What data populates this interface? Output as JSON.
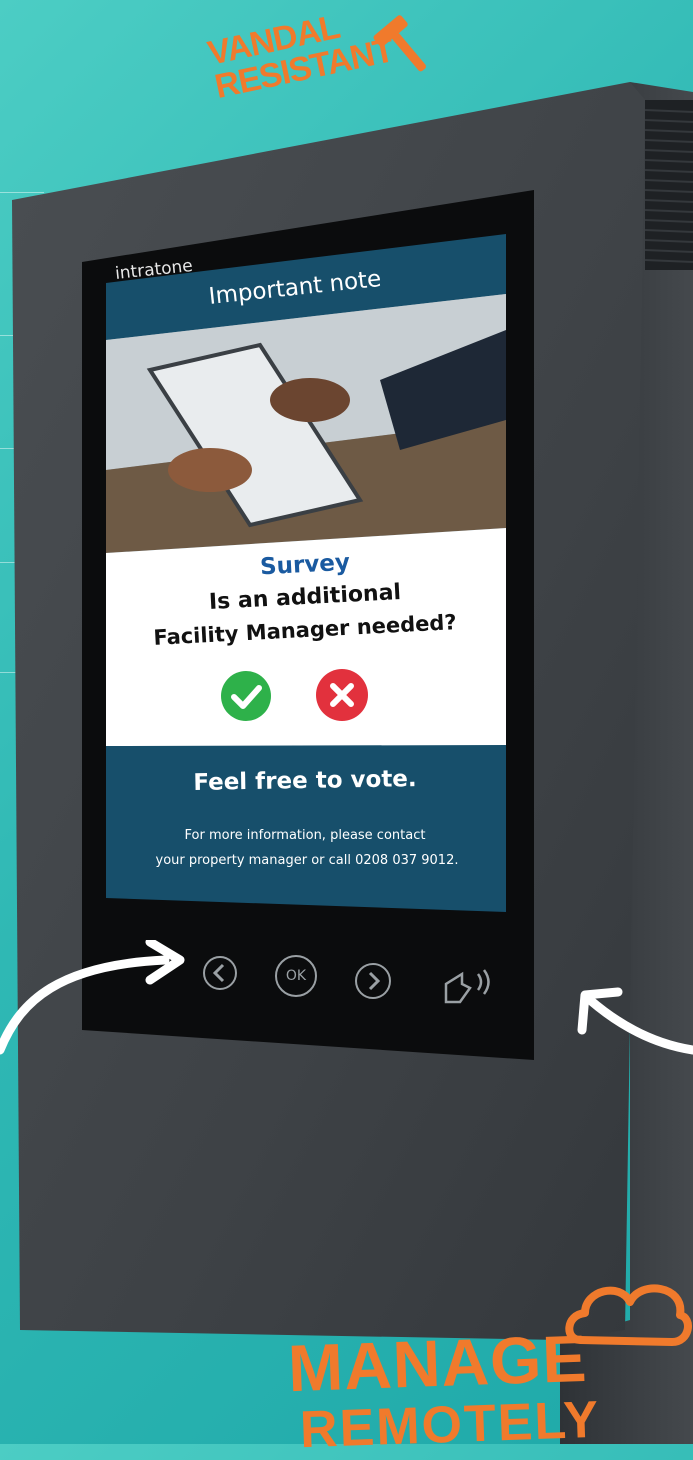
{
  "badge_top": {
    "line1": "VANDAL",
    "line2": "RESISTANT",
    "icon": "hammer-icon"
  },
  "screen": {
    "brand": "intratone",
    "header_title": "Important note",
    "photo": "hands-holding-tablet-photo",
    "survey_label": "Survey",
    "question_line1": "Is an additional",
    "question_line2": "Facility Manager needed?",
    "yes_icon": "check-circle-icon",
    "no_icon": "x-circle-icon",
    "vote_text": "Feel free to vote.",
    "info_line1": "For more information, please contact",
    "info_line2": "your property manager or call 0208 037 9012."
  },
  "keypad": {
    "prev_icon": "chevron-left-icon",
    "ok_label": "OK",
    "next_icon": "chevron-right-icon",
    "call_icon": "hand-sound-icon"
  },
  "badge_bottom": {
    "line1": "MANAGE",
    "line2": "REMOTELY",
    "icon": "cloud-icon"
  },
  "colors": {
    "teal_bg": "#35c0bb",
    "accent_orange": "#f07a2c",
    "screen_blue": "#174f6b",
    "survey_blue": "#1a5aa0",
    "yes_green": "#2eb14a",
    "no_red": "#e2313d"
  }
}
